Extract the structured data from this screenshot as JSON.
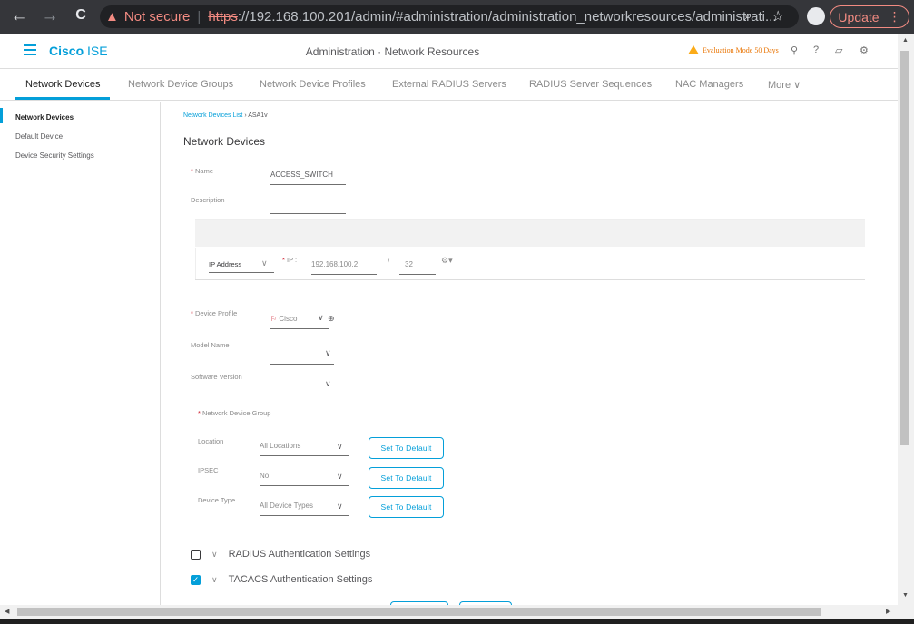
{
  "browser": {
    "back": "←",
    "forward": "→",
    "reload": "C",
    "security_warning_icon": "warning-triangle",
    "not_secure": "Not secure",
    "url_scheme": "https",
    "url_rest": "://192.168.100.201/admin/#administration/administration_networkresources/administrati...",
    "zoom_icon": "⌕",
    "star_icon": "☆",
    "update_label": "Update",
    "menu_icon": "⋮"
  },
  "header": {
    "brand_bold": "Cisco",
    "brand_light": "ISE",
    "title": "Administration · Network Resources",
    "evaluation": "Evaluation Mode 50 Days"
  },
  "tabs": [
    {
      "label": "Network Devices",
      "active": true
    },
    {
      "label": "Network Device Groups"
    },
    {
      "label": "Network Device Profiles"
    },
    {
      "label": "External RADIUS Servers"
    },
    {
      "label": "RADIUS Server Sequences"
    },
    {
      "label": "NAC Managers"
    },
    {
      "label": "More ∨"
    }
  ],
  "sidebar": {
    "items": [
      "Network Devices",
      "Default Device",
      "Device Security Settings"
    ]
  },
  "main": {
    "breadcrumb_link": "Network Devices List",
    "breadcrumb_sep": "›",
    "breadcrumb_current": "ASA1v",
    "heading": "Network Devices",
    "name_label": "Name",
    "name_value": "ACCESS_SWITCH",
    "description_label": "Description",
    "ip_type": "IP Address",
    "ip_label": "IP :",
    "ip_value": "192.168.100.2",
    "ip_slash": "/",
    "ip_mask": "32",
    "device_profile_label": "Device Profile",
    "device_profile_value": "Cisco",
    "model_name_label": "Model Name",
    "software_version_label": "Software Version",
    "ndg_label": "Network Device Group",
    "location_label": "Location",
    "location_value": "All Locations",
    "ipsec_label": "IPSEC",
    "ipsec_value": "No",
    "device_type_label": "Device Type",
    "device_type_value": "All Device Types",
    "set_default": "Set To Default",
    "radius_section": "RADIUS Authentication Settings",
    "radius_checked": false,
    "tacacs_section": "TACACS Authentication Settings",
    "tacacs_checked": true
  }
}
